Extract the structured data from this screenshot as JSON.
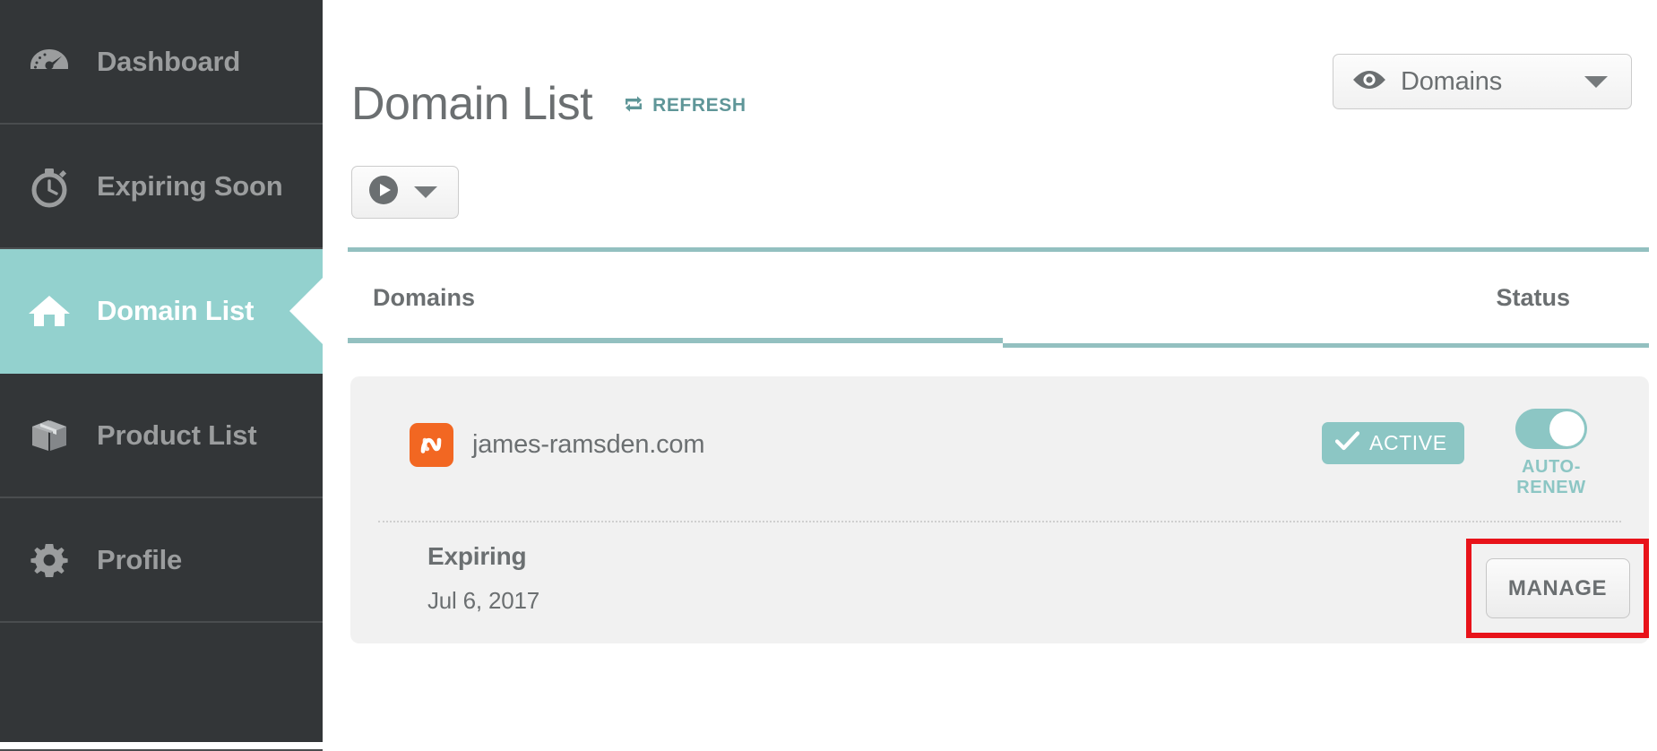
{
  "sidebar": {
    "items": [
      {
        "label": "Dashboard",
        "icon": "dashboard-gauge-icon",
        "active": false
      },
      {
        "label": "Expiring Soon",
        "icon": "stopwatch-icon",
        "active": false
      },
      {
        "label": "Domain List",
        "icon": "home-icon",
        "active": true
      },
      {
        "label": "Product List",
        "icon": "box-icon",
        "active": false
      },
      {
        "label": "Profile",
        "icon": "gear-icon",
        "active": false
      }
    ]
  },
  "header": {
    "title": "Domain List",
    "refresh_label": "REFRESH",
    "refresh_icon": "refresh-icon",
    "view_select": {
      "value": "Domains",
      "icon": "eye-icon",
      "caret_icon": "chevron-down-icon"
    }
  },
  "toolbar": {
    "actions_button": {
      "icon": "play-circle-icon",
      "caret_icon": "chevron-down-icon"
    }
  },
  "tabs": [
    {
      "label": "Domains",
      "active": true
    },
    {
      "label": "Status",
      "active": false
    }
  ],
  "domains": [
    {
      "name": "james-ramsden.com",
      "logo_icon": "namecheap-logo-icon",
      "status": {
        "label": "ACTIVE",
        "icon": "check-icon"
      },
      "auto_renew": {
        "label": "AUTO-RENEW",
        "on": true
      },
      "expiry": {
        "title": "Expiring",
        "date": "Jul 6, 2017"
      },
      "manage_label": "MANAGE"
    }
  ],
  "colors": {
    "sidebar_bg": "#333638",
    "accent_teal": "#8cc6c4",
    "active_nav": "#93d1ce",
    "brand_orange": "#f26722",
    "highlight_red": "#e8131a",
    "text_gray": "#6b6f71"
  }
}
